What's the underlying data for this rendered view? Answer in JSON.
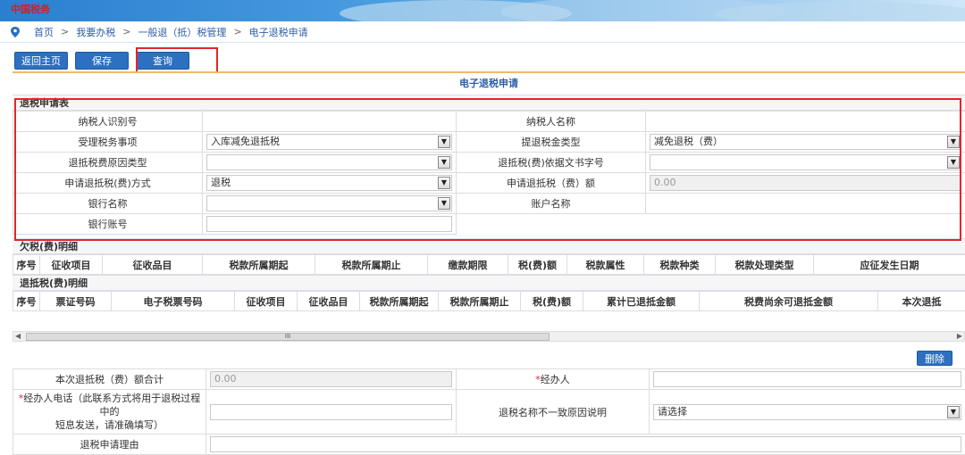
{
  "banner": {
    "logo_text": "中国税务"
  },
  "breadcrumb": {
    "items": [
      "首页",
      "我要办税",
      "一般退（抵）税管理",
      "电子退税申请"
    ],
    "separator": ">"
  },
  "toolbar": {
    "back_label": "返回主页",
    "save_label": "保存",
    "query_label": "查询",
    "delete_label": "删除"
  },
  "panel": {
    "title": "电子退税申请"
  },
  "form": {
    "section_title": "退税申请表",
    "taxpayer_id_label": "纳税人识别号",
    "taxpayer_name_label": "纳税人名称",
    "tax_matter_label": "受理税务事项",
    "tax_matter_value": "入库减免退抵税",
    "refund_type_label": "提退税金类型",
    "refund_type_value": "减免退税（费）",
    "reason_type_label": "退抵税费原因类型",
    "doc_no_label": "退抵税(费)依据文书字号",
    "method_label": "申请退抵税(费)方式",
    "method_value": "退税",
    "amount_label": "申请退抵税（费）额",
    "amount_value": "0.00",
    "bank_name_label": "银行名称",
    "account_name_label": "账户名称",
    "bank_account_label": "银行账号"
  },
  "arrears": {
    "title": "欠税(费)明细",
    "columns": [
      "序号",
      "征收项目",
      "征收品目",
      "税款所属期起",
      "税款所属期止",
      "缴款期限",
      "税(费)额",
      "税款属性",
      "税款种类",
      "税款处理类型",
      "应征发生日期"
    ]
  },
  "refund_detail": {
    "title": "退抵税(费)明细",
    "columns": [
      "序号",
      "票证号码",
      "电子税票号码",
      "征收项目",
      "征收品目",
      "税款所属期起",
      "税款所属期止",
      "税(费)额",
      "累计已退抵金额",
      "税费尚余可退抵金额",
      "本次退抵"
    ]
  },
  "scroll_thumb_text": "III",
  "bottom": {
    "total_label": "本次退抵税（费）额合计",
    "total_value": "0.00",
    "handler_label": "经办人",
    "phone_label_line1": "经办人电话（此联系方式将用于退税过程中的",
    "phone_label_line2": "短息发送，请准确填写）",
    "mismatch_label": "退税名称不一致原因说明",
    "mismatch_value": "请选择",
    "reason_label": "退税申请理由",
    "required_mark": "*"
  }
}
